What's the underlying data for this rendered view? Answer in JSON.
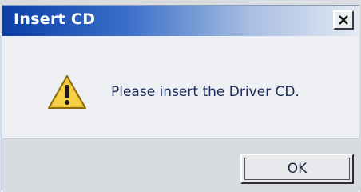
{
  "dialog": {
    "title": "Insert CD",
    "close_icon": "close-icon",
    "icon": "warning-icon",
    "message": "Please insert the Driver CD.",
    "ok_label": "OK"
  },
  "colors": {
    "titlebar_start": "#0c3fa8",
    "titlebar_end": "#e3e9f3",
    "warning_fill": "#f2c230"
  }
}
